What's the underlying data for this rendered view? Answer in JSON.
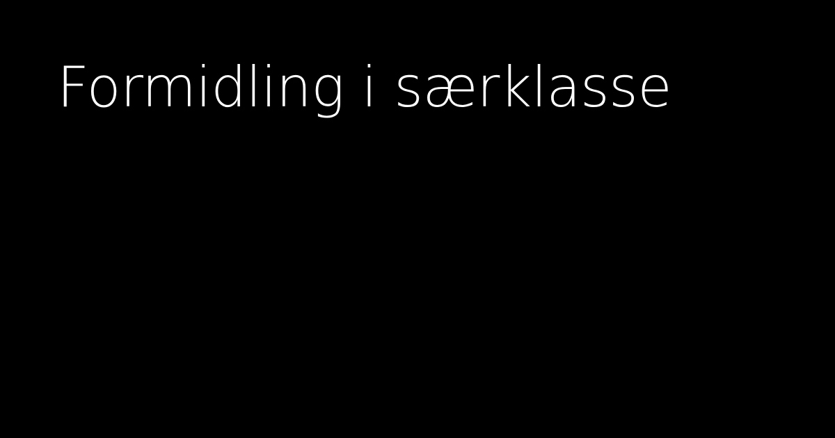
{
  "headline": {
    "text": "Formidling i særklasse"
  },
  "colors": {
    "background": "#000000",
    "text": "#ffffff"
  }
}
